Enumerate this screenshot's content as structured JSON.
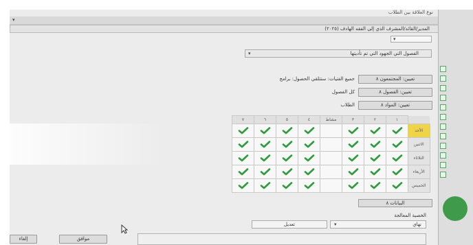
{
  "dialog": {
    "title": "نوع العلاقة بين الطلاب",
    "top_combo_value": "المدير/القائد/المشرف الذي إلى الفقه الهادف (٢٠٢٥)"
  },
  "scope_combo": {
    "value": "الفصول التي الجهود التي تم تأديتها"
  },
  "options": [
    {
      "button": "تعيين: المجتمعون ٨",
      "label": "جميع الفتيات: ستتلقي الحصول: برامج"
    },
    {
      "button": "تعيين: الفصول ٨",
      "label": "كل الفصول"
    },
    {
      "button": "تعيين: المواد ٨",
      "label": "الطلاب"
    }
  ],
  "grid": {
    "columns": [
      "١",
      "٢",
      "٣",
      "مشاط",
      "٤",
      "٥",
      "٦",
      "٧"
    ],
    "highlight_column": "٣",
    "rows": [
      {
        "label": "الأحد",
        "highlight": true,
        "checks": [
          true,
          true,
          true,
          false,
          true,
          true,
          true,
          true
        ]
      },
      {
        "label": "الاثنين",
        "highlight": false,
        "checks": [
          true,
          true,
          true,
          false,
          true,
          true,
          true,
          true
        ]
      },
      {
        "label": "الثلاثاء",
        "highlight": false,
        "checks": [
          true,
          true,
          true,
          false,
          true,
          true,
          true,
          true
        ]
      },
      {
        "label": "الأربعاء",
        "highlight": false,
        "checks": [
          true,
          true,
          true,
          false,
          true,
          true,
          true,
          true
        ]
      },
      {
        "label": "الخميس",
        "highlight": false,
        "checks": [
          true,
          true,
          true,
          false,
          true,
          true,
          true,
          true
        ]
      }
    ]
  },
  "lower": {
    "button": "البيانات ٨",
    "section_label": "الخصية المعالجة",
    "field_label": "تعديل",
    "field_value": "نهاي"
  },
  "footer": {
    "ok_label": "موافق",
    "cancel_label": "إلغاء"
  },
  "colors": {
    "check": "#2e9b3a",
    "highlight": "#f0d447"
  }
}
